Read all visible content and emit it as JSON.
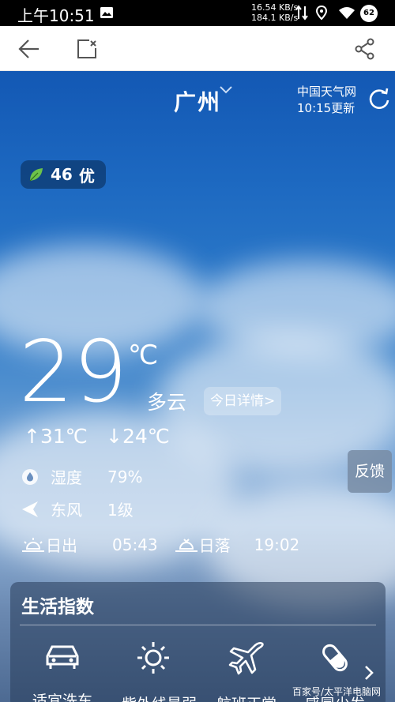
{
  "status_bar": {
    "time": "上午10:51",
    "net_up": "16.54 KB/s",
    "net_down": "184.1 KB/s",
    "battery": "62"
  },
  "toolbar": {
    "icons": [
      "back-arrow-icon",
      "close-page-icon",
      "share-icon"
    ]
  },
  "header": {
    "city": "广州",
    "source": "中国天气网",
    "updated": "10:15更新"
  },
  "air_quality": {
    "value": "46",
    "level": "优",
    "icon": "leaf-icon",
    "color": "#6cc24a"
  },
  "current": {
    "temperature": "29",
    "unit": "℃",
    "condition": "多云",
    "detail_button": "今日详情>",
    "high": "↑31℃",
    "low": "↓24℃"
  },
  "details": {
    "humidity_label": "湿度",
    "humidity_value": "79%",
    "wind_dir": "东风",
    "wind_level": "1级",
    "sunrise_label": "日出",
    "sunrise_time": "05:43",
    "sunset_label": "日落",
    "sunset_time": "19:02"
  },
  "feedback": "反馈",
  "life_index": {
    "title": "生活指数",
    "items": [
      {
        "label": "适宜洗车",
        "icon": "car-icon"
      },
      {
        "label": "紫外线最弱",
        "icon": "sun-icon"
      },
      {
        "label": "航班正常",
        "icon": "plane-icon"
      },
      {
        "label": "感冒少发",
        "icon": "pill-icon"
      }
    ]
  },
  "watermark": "百家号/太平洋电脑网"
}
